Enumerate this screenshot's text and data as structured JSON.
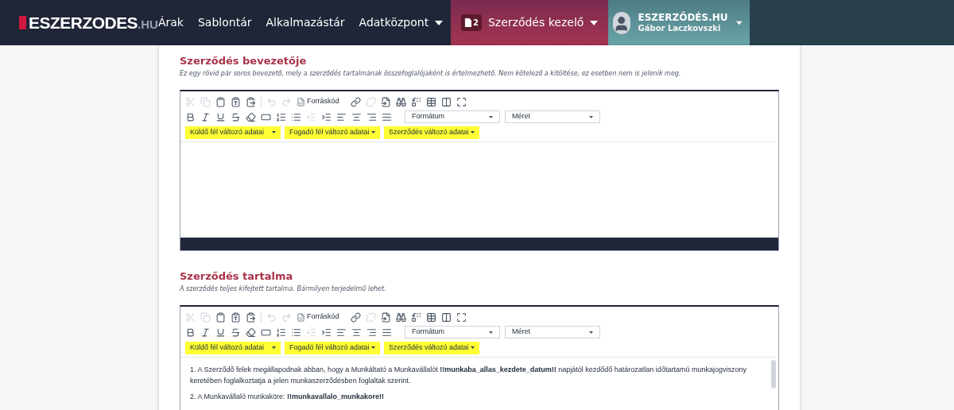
{
  "navbar": {
    "logo": {
      "name": "ESZERZODES",
      "suffix": ".HU"
    },
    "menu": [
      {
        "label": "Árak",
        "dropdown": false
      },
      {
        "label": "Sablontár",
        "dropdown": false
      },
      {
        "label": "Alkalmazástár",
        "dropdown": false
      },
      {
        "label": "Adatközpont",
        "dropdown": true
      }
    ],
    "contracts": {
      "count": "2",
      "label": "Szerződés kezelő"
    },
    "user": {
      "company": "ESZERZŐDÉS.HU",
      "name": "Gábor Laczkovszki"
    }
  },
  "sections": [
    {
      "title": "Szerződés bevezetője",
      "hint": "Ez egy rövid pár soros bevezető, mely a szerződés tartalmának összefoglalójaként is értelmezhető. Nem kötelező a kitöltése, ez esetben nem is jelenik meg.",
      "editor": {
        "source_button": "Forráskód",
        "format": "Formátum",
        "size": "Méret",
        "variables": [
          "Küldő fél változó adatai",
          "Fogadó fél változó adatai",
          "Szerződés változó adatai"
        ],
        "status_bar": true
      }
    },
    {
      "title": "Szerződés tartalma",
      "hint": "A szerződés teljes kifejtett tartalma. Bármilyen terjedelmű lehet.",
      "editor": {
        "source_button": "Forráskód",
        "format": "Formátum",
        "size": "Méret",
        "variables": [
          "Küldő fél változó adatai",
          "Fogadó fél változó adatai",
          "Szerződés változó adatai"
        ],
        "paragraphs": [
          "1. A Szerződő felek megállapodnak abban, hogy a Munkáltató a Munkavállalót **!!munkaba_allas_kezdete_datum!!** napjától kezdődő határozatlan időtartamú munkajogviszony keretében foglalkoztatja a jelen munkaszerződésben foglaltak szerint.",
          "2. A Munkavállaló munkaköre: **!!munkavallalo_munkakore!!**"
        ],
        "status_bar": false
      }
    }
  ]
}
